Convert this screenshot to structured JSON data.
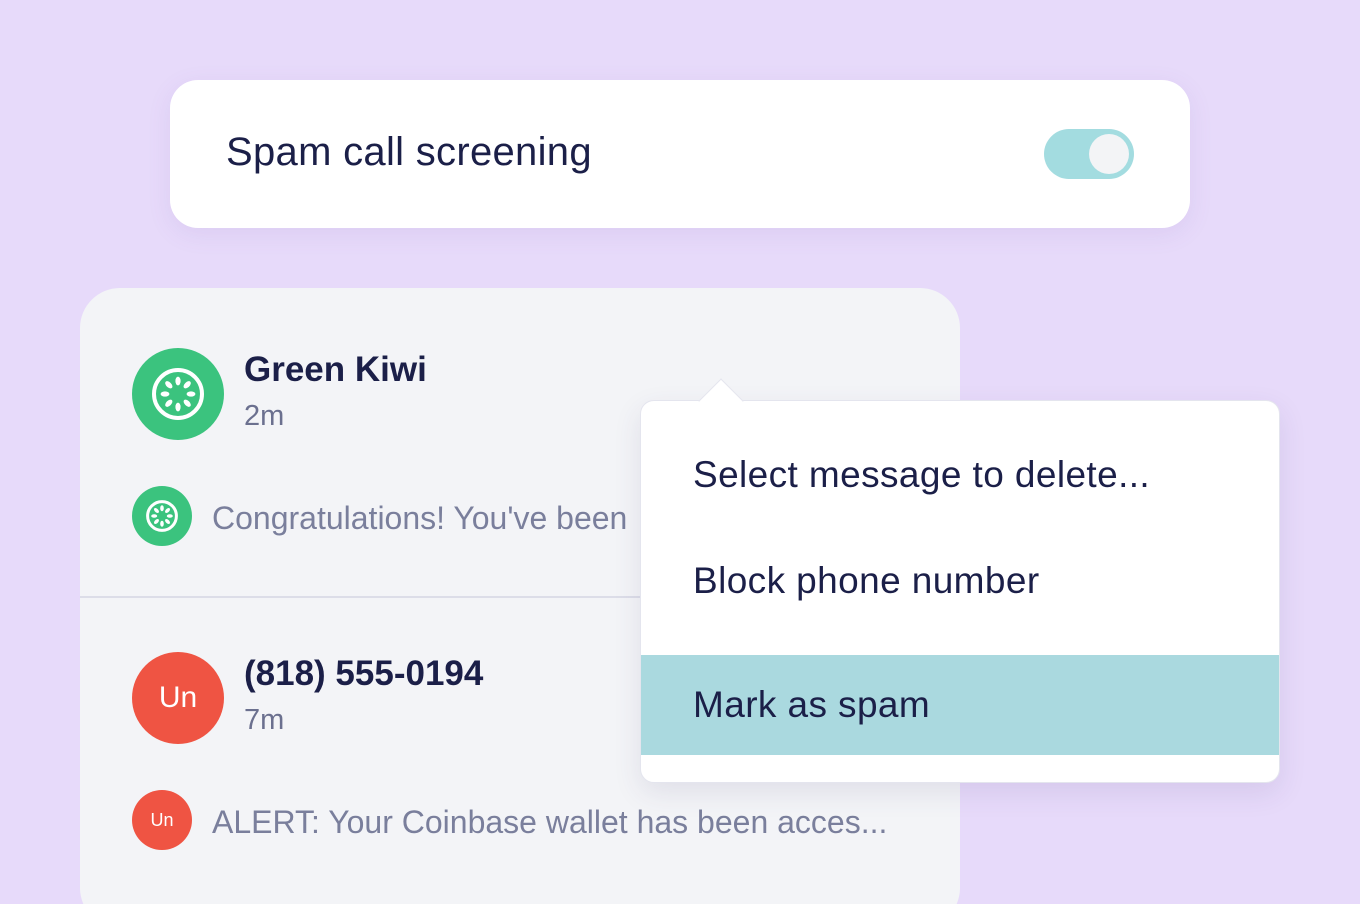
{
  "settings": {
    "spam_screening_label": "Spam call screening",
    "spam_screening_enabled": true
  },
  "conversations": [
    {
      "name": "Green Kiwi",
      "time": "2m",
      "avatar": {
        "type": "icon",
        "icon": "kiwi-icon",
        "color": "#3bc37e"
      },
      "preview": "Congratulations! You've been"
    },
    {
      "name": "(818) 555-0194",
      "time": "7m",
      "avatar": {
        "type": "initials",
        "initials": "Un",
        "color": "#ef5443"
      },
      "preview": "ALERT: Your Coinbase wallet has been acces..."
    }
  ],
  "context_menu": {
    "items": [
      {
        "label": "Select message to delete..."
      },
      {
        "label": "Block phone number"
      },
      {
        "label": "Mark as spam",
        "highlighted": true
      }
    ]
  },
  "colors": {
    "background": "#e7dafa",
    "toggle_on": "#a3dce0",
    "menu_highlight": "#aad9df",
    "green_avatar": "#3bc37e",
    "red_avatar": "#ef5443"
  }
}
